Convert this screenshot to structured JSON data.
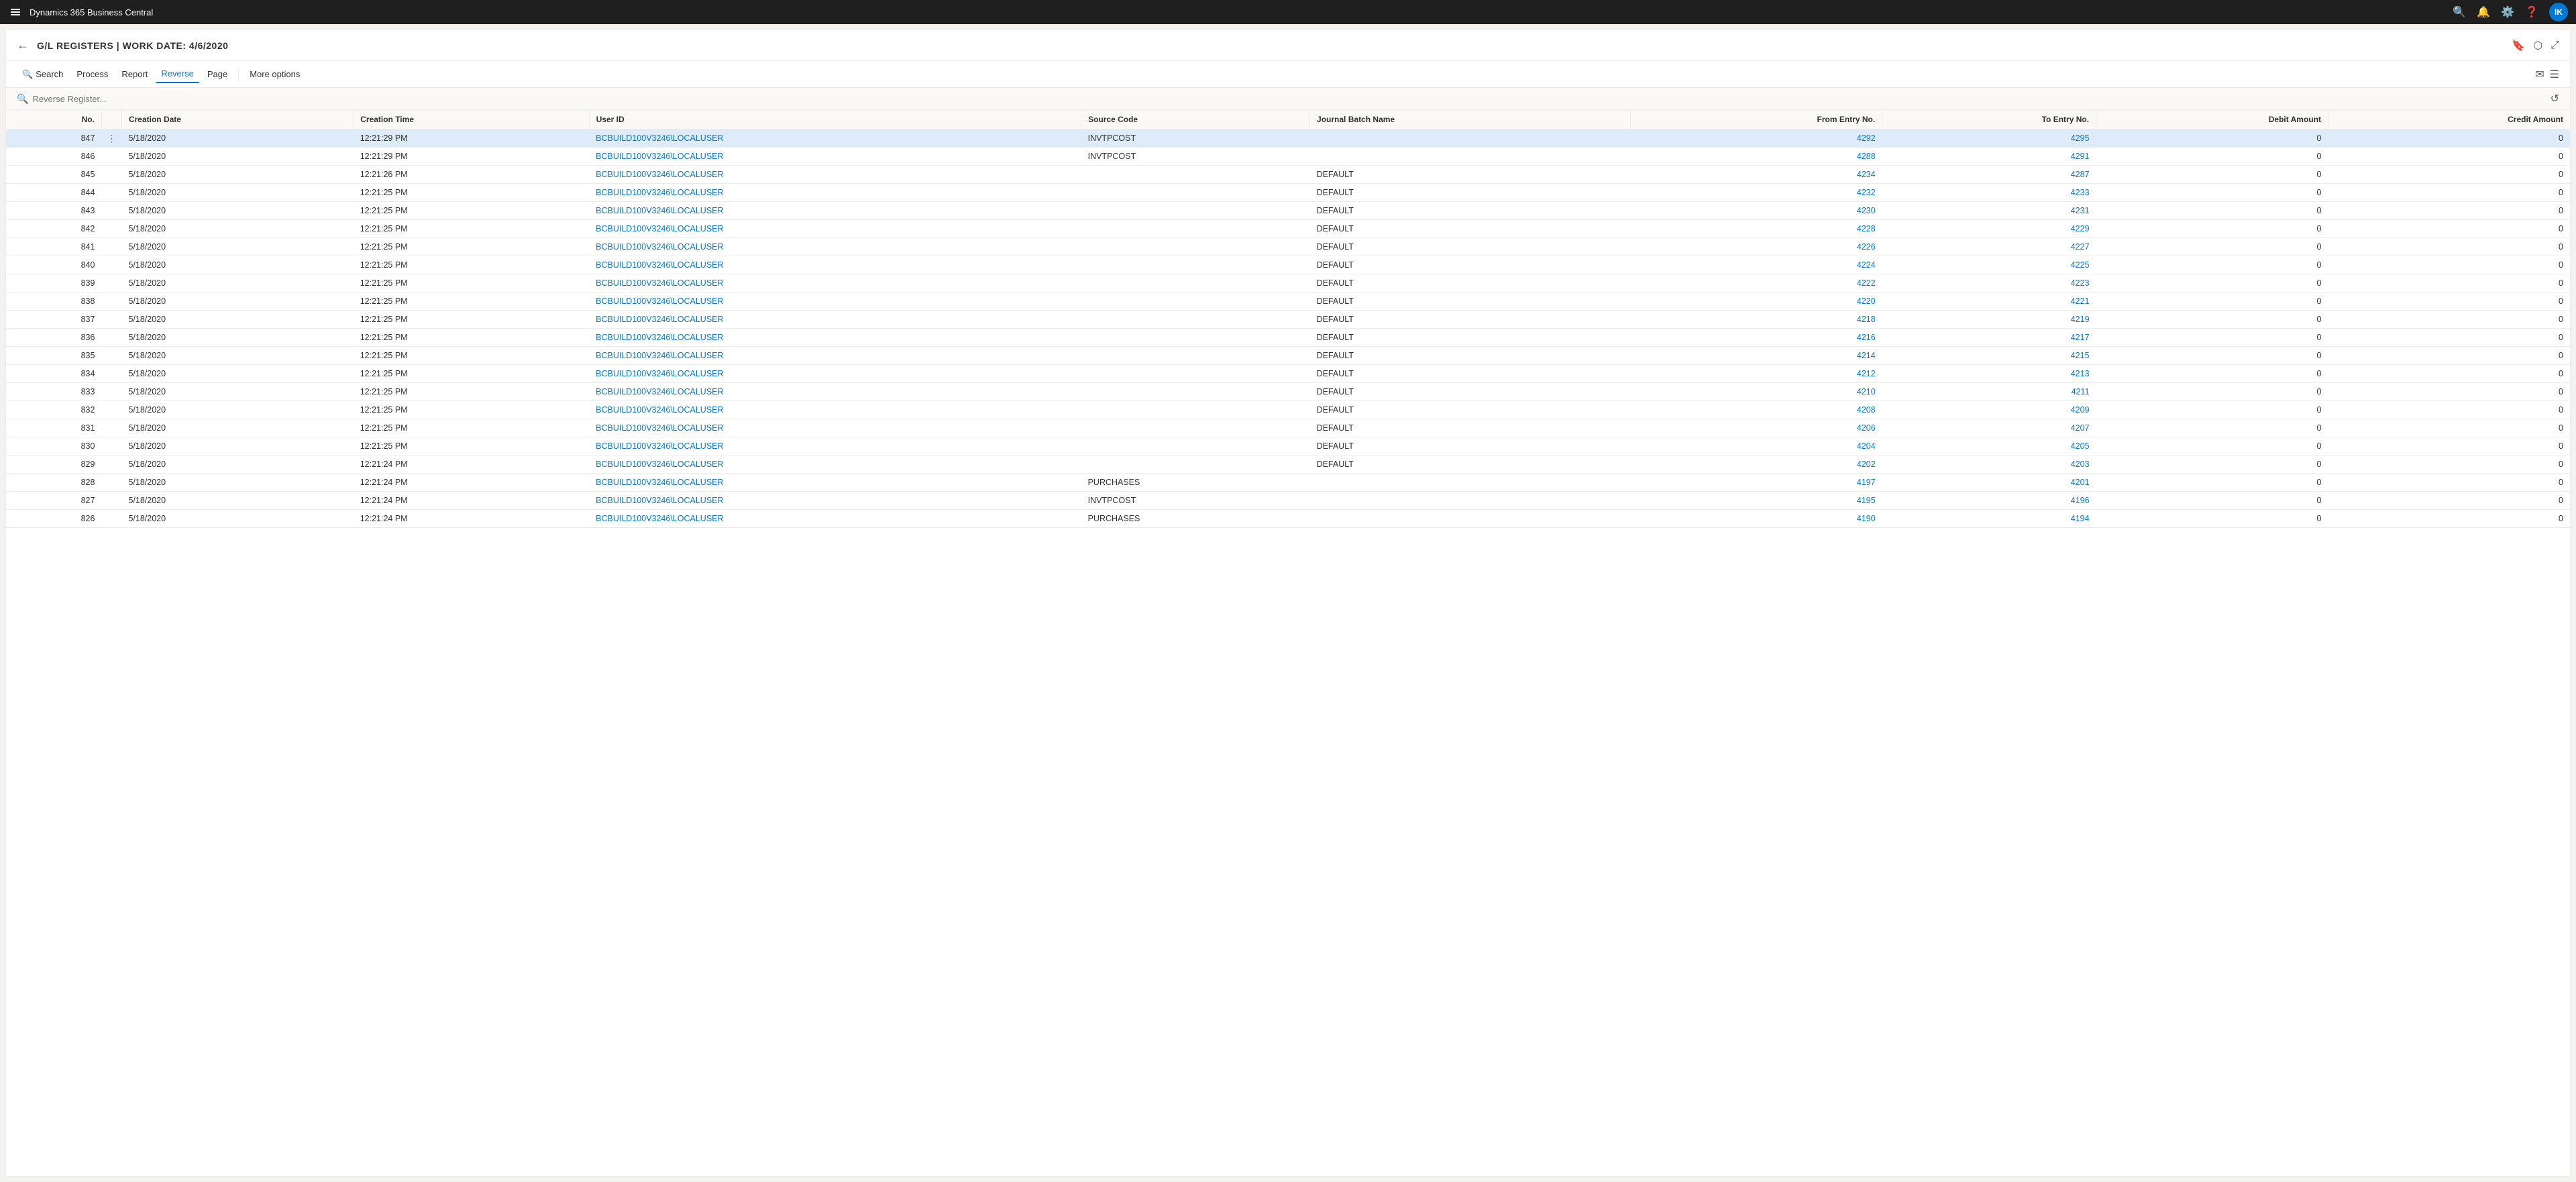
{
  "app": {
    "title": "Dynamics 365 Business Central"
  },
  "topNav": {
    "icons": [
      "search",
      "bell",
      "settings",
      "help"
    ],
    "userInitials": "IK"
  },
  "page": {
    "title": "G/L REGISTERS | WORK DATE: 4/6/2020",
    "breadcrumb": "G/L REGISTERS | WORK DATE: 4/6/2020"
  },
  "toolbar": {
    "search_label": "Search",
    "process_label": "Process",
    "report_label": "Report",
    "reverse_label": "Reverse",
    "page_label": "Page",
    "more_options_label": "More options"
  },
  "searchBar": {
    "placeholder": "Reverse Register..."
  },
  "table": {
    "columns": [
      {
        "key": "no",
        "label": "No."
      },
      {
        "key": "menu",
        "label": ""
      },
      {
        "key": "creation_date",
        "label": "Creation Date"
      },
      {
        "key": "creation_time",
        "label": "Creation Time"
      },
      {
        "key": "user_id",
        "label": "User ID"
      },
      {
        "key": "source_code",
        "label": "Source Code"
      },
      {
        "key": "journal_batch",
        "label": "Journal Batch Name"
      },
      {
        "key": "from_entry",
        "label": "From Entry No."
      },
      {
        "key": "to_entry",
        "label": "To Entry No."
      },
      {
        "key": "debit_amount",
        "label": "Debit Amount"
      },
      {
        "key": "credit_amount",
        "label": "Credit Amount"
      }
    ],
    "rows": [
      {
        "no": "847",
        "selected": true,
        "has_menu": true,
        "creation_date": "5/18/2020",
        "creation_time": "12:21:29 PM",
        "user_id": "BCBUILD100V3246\\LOCALUSER",
        "source_code": "INVTPCOST",
        "journal_batch": "",
        "from_entry": "4292",
        "to_entry": "4295",
        "debit_amount": "0",
        "credit_amount": "0"
      },
      {
        "no": "846",
        "selected": false,
        "has_menu": false,
        "creation_date": "5/18/2020",
        "creation_time": "12:21:29 PM",
        "user_id": "BCBUILD100V3246\\LOCALUSER",
        "source_code": "INVTPCOST",
        "journal_batch": "",
        "from_entry": "4288",
        "to_entry": "4291",
        "debit_amount": "0",
        "credit_amount": "0"
      },
      {
        "no": "845",
        "selected": false,
        "has_menu": false,
        "creation_date": "5/18/2020",
        "creation_time": "12:21:26 PM",
        "user_id": "BCBUILD100V3246\\LOCALUSER",
        "source_code": "",
        "journal_batch": "DEFAULT",
        "from_entry": "4234",
        "to_entry": "4287",
        "debit_amount": "0",
        "credit_amount": "0"
      },
      {
        "no": "844",
        "selected": false,
        "has_menu": false,
        "creation_date": "5/18/2020",
        "creation_time": "12:21:25 PM",
        "user_id": "BCBUILD100V3246\\LOCALUSER",
        "source_code": "",
        "journal_batch": "DEFAULT",
        "from_entry": "4232",
        "to_entry": "4233",
        "debit_amount": "0",
        "credit_amount": "0"
      },
      {
        "no": "843",
        "selected": false,
        "has_menu": false,
        "creation_date": "5/18/2020",
        "creation_time": "12:21:25 PM",
        "user_id": "BCBUILD100V3246\\LOCALUSER",
        "source_code": "",
        "journal_batch": "DEFAULT",
        "from_entry": "4230",
        "to_entry": "4231",
        "debit_amount": "0",
        "credit_amount": "0"
      },
      {
        "no": "842",
        "selected": false,
        "has_menu": false,
        "creation_date": "5/18/2020",
        "creation_time": "12:21:25 PM",
        "user_id": "BCBUILD100V3246\\LOCALUSER",
        "source_code": "",
        "journal_batch": "DEFAULT",
        "from_entry": "4228",
        "to_entry": "4229",
        "debit_amount": "0",
        "credit_amount": "0"
      },
      {
        "no": "841",
        "selected": false,
        "has_menu": false,
        "creation_date": "5/18/2020",
        "creation_time": "12:21:25 PM",
        "user_id": "BCBUILD100V3246\\LOCALUSER",
        "source_code": "",
        "journal_batch": "DEFAULT",
        "from_entry": "4226",
        "to_entry": "4227",
        "debit_amount": "0",
        "credit_amount": "0"
      },
      {
        "no": "840",
        "selected": false,
        "has_menu": false,
        "creation_date": "5/18/2020",
        "creation_time": "12:21:25 PM",
        "user_id": "BCBUILD100V3246\\LOCALUSER",
        "source_code": "",
        "journal_batch": "DEFAULT",
        "from_entry": "4224",
        "to_entry": "4225",
        "debit_amount": "0",
        "credit_amount": "0"
      },
      {
        "no": "839",
        "selected": false,
        "has_menu": false,
        "creation_date": "5/18/2020",
        "creation_time": "12:21:25 PM",
        "user_id": "BCBUILD100V3246\\LOCALUSER",
        "source_code": "",
        "journal_batch": "DEFAULT",
        "from_entry": "4222",
        "to_entry": "4223",
        "debit_amount": "0",
        "credit_amount": "0"
      },
      {
        "no": "838",
        "selected": false,
        "has_menu": false,
        "creation_date": "5/18/2020",
        "creation_time": "12:21:25 PM",
        "user_id": "BCBUILD100V3246\\LOCALUSER",
        "source_code": "",
        "journal_batch": "DEFAULT",
        "from_entry": "4220",
        "to_entry": "4221",
        "debit_amount": "0",
        "credit_amount": "0"
      },
      {
        "no": "837",
        "selected": false,
        "has_menu": false,
        "creation_date": "5/18/2020",
        "creation_time": "12:21:25 PM",
        "user_id": "BCBUILD100V3246\\LOCALUSER",
        "source_code": "",
        "journal_batch": "DEFAULT",
        "from_entry": "4218",
        "to_entry": "4219",
        "debit_amount": "0",
        "credit_amount": "0"
      },
      {
        "no": "836",
        "selected": false,
        "has_menu": false,
        "creation_date": "5/18/2020",
        "creation_time": "12:21:25 PM",
        "user_id": "BCBUILD100V3246\\LOCALUSER",
        "source_code": "",
        "journal_batch": "DEFAULT",
        "from_entry": "4216",
        "to_entry": "4217",
        "debit_amount": "0",
        "credit_amount": "0"
      },
      {
        "no": "835",
        "selected": false,
        "has_menu": false,
        "creation_date": "5/18/2020",
        "creation_time": "12:21:25 PM",
        "user_id": "BCBUILD100V3246\\LOCALUSER",
        "source_code": "",
        "journal_batch": "DEFAULT",
        "from_entry": "4214",
        "to_entry": "4215",
        "debit_amount": "0",
        "credit_amount": "0"
      },
      {
        "no": "834",
        "selected": false,
        "has_menu": false,
        "creation_date": "5/18/2020",
        "creation_time": "12:21:25 PM",
        "user_id": "BCBUILD100V3246\\LOCALUSER",
        "source_code": "",
        "journal_batch": "DEFAULT",
        "from_entry": "4212",
        "to_entry": "4213",
        "debit_amount": "0",
        "credit_amount": "0"
      },
      {
        "no": "833",
        "selected": false,
        "has_menu": false,
        "creation_date": "5/18/2020",
        "creation_time": "12:21:25 PM",
        "user_id": "BCBUILD100V3246\\LOCALUSER",
        "source_code": "",
        "journal_batch": "DEFAULT",
        "from_entry": "4210",
        "to_entry": "4211",
        "debit_amount": "0",
        "credit_amount": "0"
      },
      {
        "no": "832",
        "selected": false,
        "has_menu": false,
        "creation_date": "5/18/2020",
        "creation_time": "12:21:25 PM",
        "user_id": "BCBUILD100V3246\\LOCALUSER",
        "source_code": "",
        "journal_batch": "DEFAULT",
        "from_entry": "4208",
        "to_entry": "4209",
        "debit_amount": "0",
        "credit_amount": "0"
      },
      {
        "no": "831",
        "selected": false,
        "has_menu": false,
        "creation_date": "5/18/2020",
        "creation_time": "12:21:25 PM",
        "user_id": "BCBUILD100V3246\\LOCALUSER",
        "source_code": "",
        "journal_batch": "DEFAULT",
        "from_entry": "4206",
        "to_entry": "4207",
        "debit_amount": "0",
        "credit_amount": "0"
      },
      {
        "no": "830",
        "selected": false,
        "has_menu": false,
        "creation_date": "5/18/2020",
        "creation_time": "12:21:25 PM",
        "user_id": "BCBUILD100V3246\\LOCALUSER",
        "source_code": "",
        "journal_batch": "DEFAULT",
        "from_entry": "4204",
        "to_entry": "4205",
        "debit_amount": "0",
        "credit_amount": "0"
      },
      {
        "no": "829",
        "selected": false,
        "has_menu": false,
        "creation_date": "5/18/2020",
        "creation_time": "12:21:24 PM",
        "user_id": "BCBUILD100V3246\\LOCALUSER",
        "source_code": "",
        "journal_batch": "DEFAULT",
        "from_entry": "4202",
        "to_entry": "4203",
        "debit_amount": "0",
        "credit_amount": "0"
      },
      {
        "no": "828",
        "selected": false,
        "has_menu": false,
        "creation_date": "5/18/2020",
        "creation_time": "12:21:24 PM",
        "user_id": "BCBUILD100V3246\\LOCALUSER",
        "source_code": "PURCHASES",
        "journal_batch": "",
        "from_entry": "4197",
        "to_entry": "4201",
        "debit_amount": "0",
        "credit_amount": "0"
      },
      {
        "no": "827",
        "selected": false,
        "has_menu": false,
        "creation_date": "5/18/2020",
        "creation_time": "12:21:24 PM",
        "user_id": "BCBUILD100V3246\\LOCALUSER",
        "source_code": "INVTPCOST",
        "journal_batch": "",
        "from_entry": "4195",
        "to_entry": "4196",
        "debit_amount": "0",
        "credit_amount": "0"
      },
      {
        "no": "826",
        "selected": false,
        "has_menu": false,
        "creation_date": "5/18/2020",
        "creation_time": "12:21:24 PM",
        "user_id": "BCBUILD100V3246\\LOCALUSER",
        "source_code": "PURCHASES",
        "journal_batch": "",
        "from_entry": "4190",
        "to_entry": "4194",
        "debit_amount": "0",
        "credit_amount": "0"
      }
    ]
  }
}
